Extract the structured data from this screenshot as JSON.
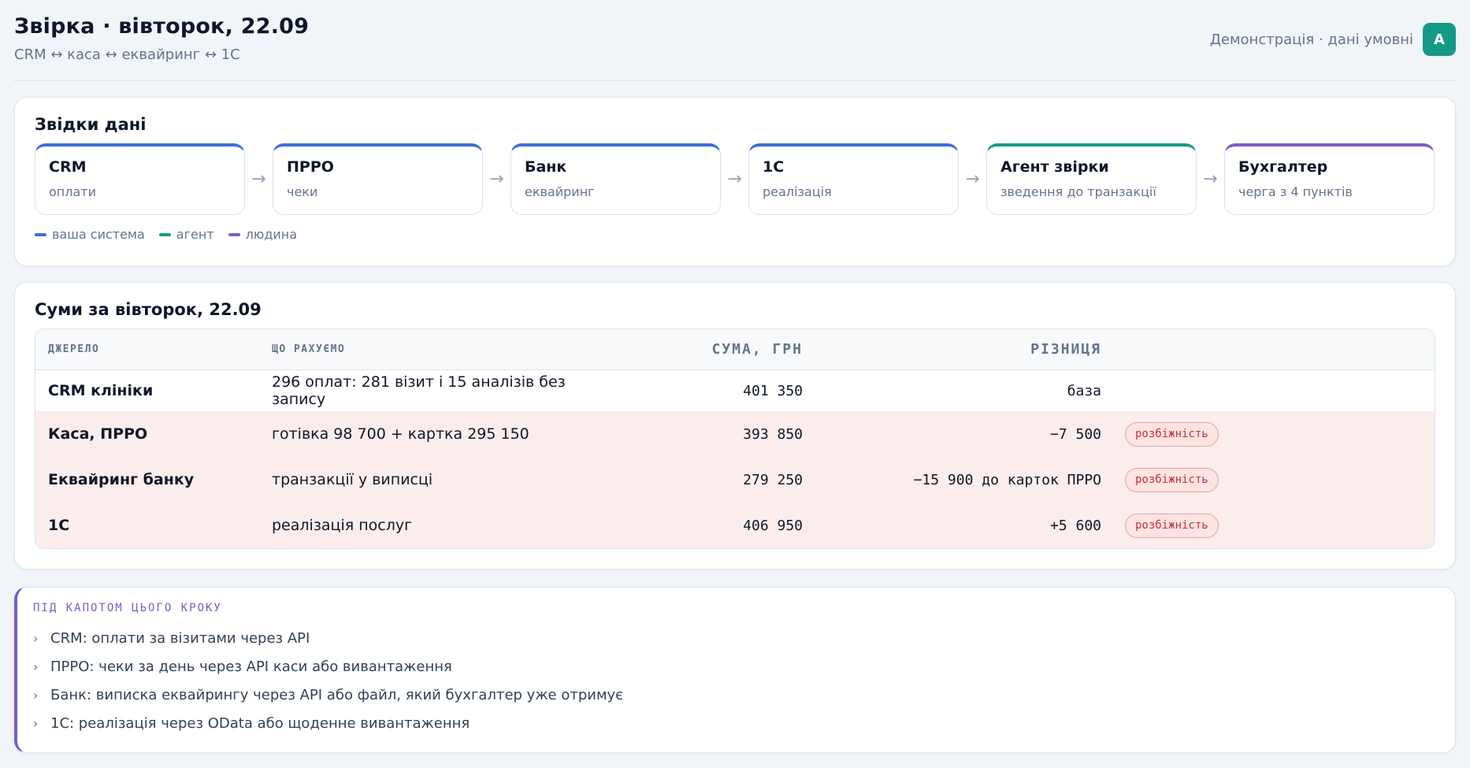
{
  "header": {
    "title": "Звірка · вівторок, 22.09",
    "subtitle": "CRM ↔ каса ↔ еквайринг ↔ 1С",
    "demo_label": "Демонстрація · дані умовні",
    "avatar_letter": "A"
  },
  "sources": {
    "title": "Звідки дані",
    "nodes": [
      {
        "title": "CRM",
        "subtitle": "оплати",
        "role": "system"
      },
      {
        "title": "ПРРО",
        "subtitle": "чеки",
        "role": "system"
      },
      {
        "title": "Банк",
        "subtitle": "еквайринг",
        "role": "system"
      },
      {
        "title": "1С",
        "subtitle": "реалізація",
        "role": "system"
      },
      {
        "title": "Агент звірки",
        "subtitle": "зведення до транзакції",
        "role": "agent"
      },
      {
        "title": "Бухгалтер",
        "subtitle": "черга з 4 пунктів",
        "role": "human"
      }
    ],
    "arrow": "→",
    "legend": [
      {
        "label": "ваша система",
        "color": "#3a6fd8"
      },
      {
        "label": "агент",
        "color": "#179b86"
      },
      {
        "label": "людина",
        "color": "#7c5cc6"
      }
    ]
  },
  "sums": {
    "title": "Суми за вівторок, 22.09",
    "columns": [
      "ДЖЕРЕЛО",
      "ЩО РАХУЄМО",
      "СУМА, ГРН",
      "РІЗНИЦЯ"
    ],
    "rows": [
      {
        "source": "CRM клініки",
        "what": "296 оплат: 281 візит і 15 аналізів без запису",
        "sum": "401 350",
        "diff": "база",
        "badge": ""
      },
      {
        "source": "Каса, ПРРО",
        "what": "готівка 98 700 + картка 295 150",
        "sum": "393 850",
        "diff": "−7 500",
        "badge": "розбіжність"
      },
      {
        "source": "Еквайринг банку",
        "what": "транзакції у виписці",
        "sum": "279 250",
        "diff": "−15 900 до карток ПРРО",
        "badge": "розбіжність"
      },
      {
        "source": "1С",
        "what": "реалізація послуг",
        "sum": "406 950",
        "diff": "+5 600",
        "badge": "розбіжність"
      }
    ]
  },
  "under_the_hood": {
    "title": "ПІД КАПОТОМ ЦЬОГО КРОКУ",
    "items": [
      "CRM: оплати за візитами через API",
      "ПРРО: чеки за день через API каси або вивантаження",
      "Банк: виписка еквайрингу через API або файл, який бухгалтер уже отримує",
      "1С: реалізація через OData або щоденне вивантаження"
    ],
    "bullet": "›"
  }
}
